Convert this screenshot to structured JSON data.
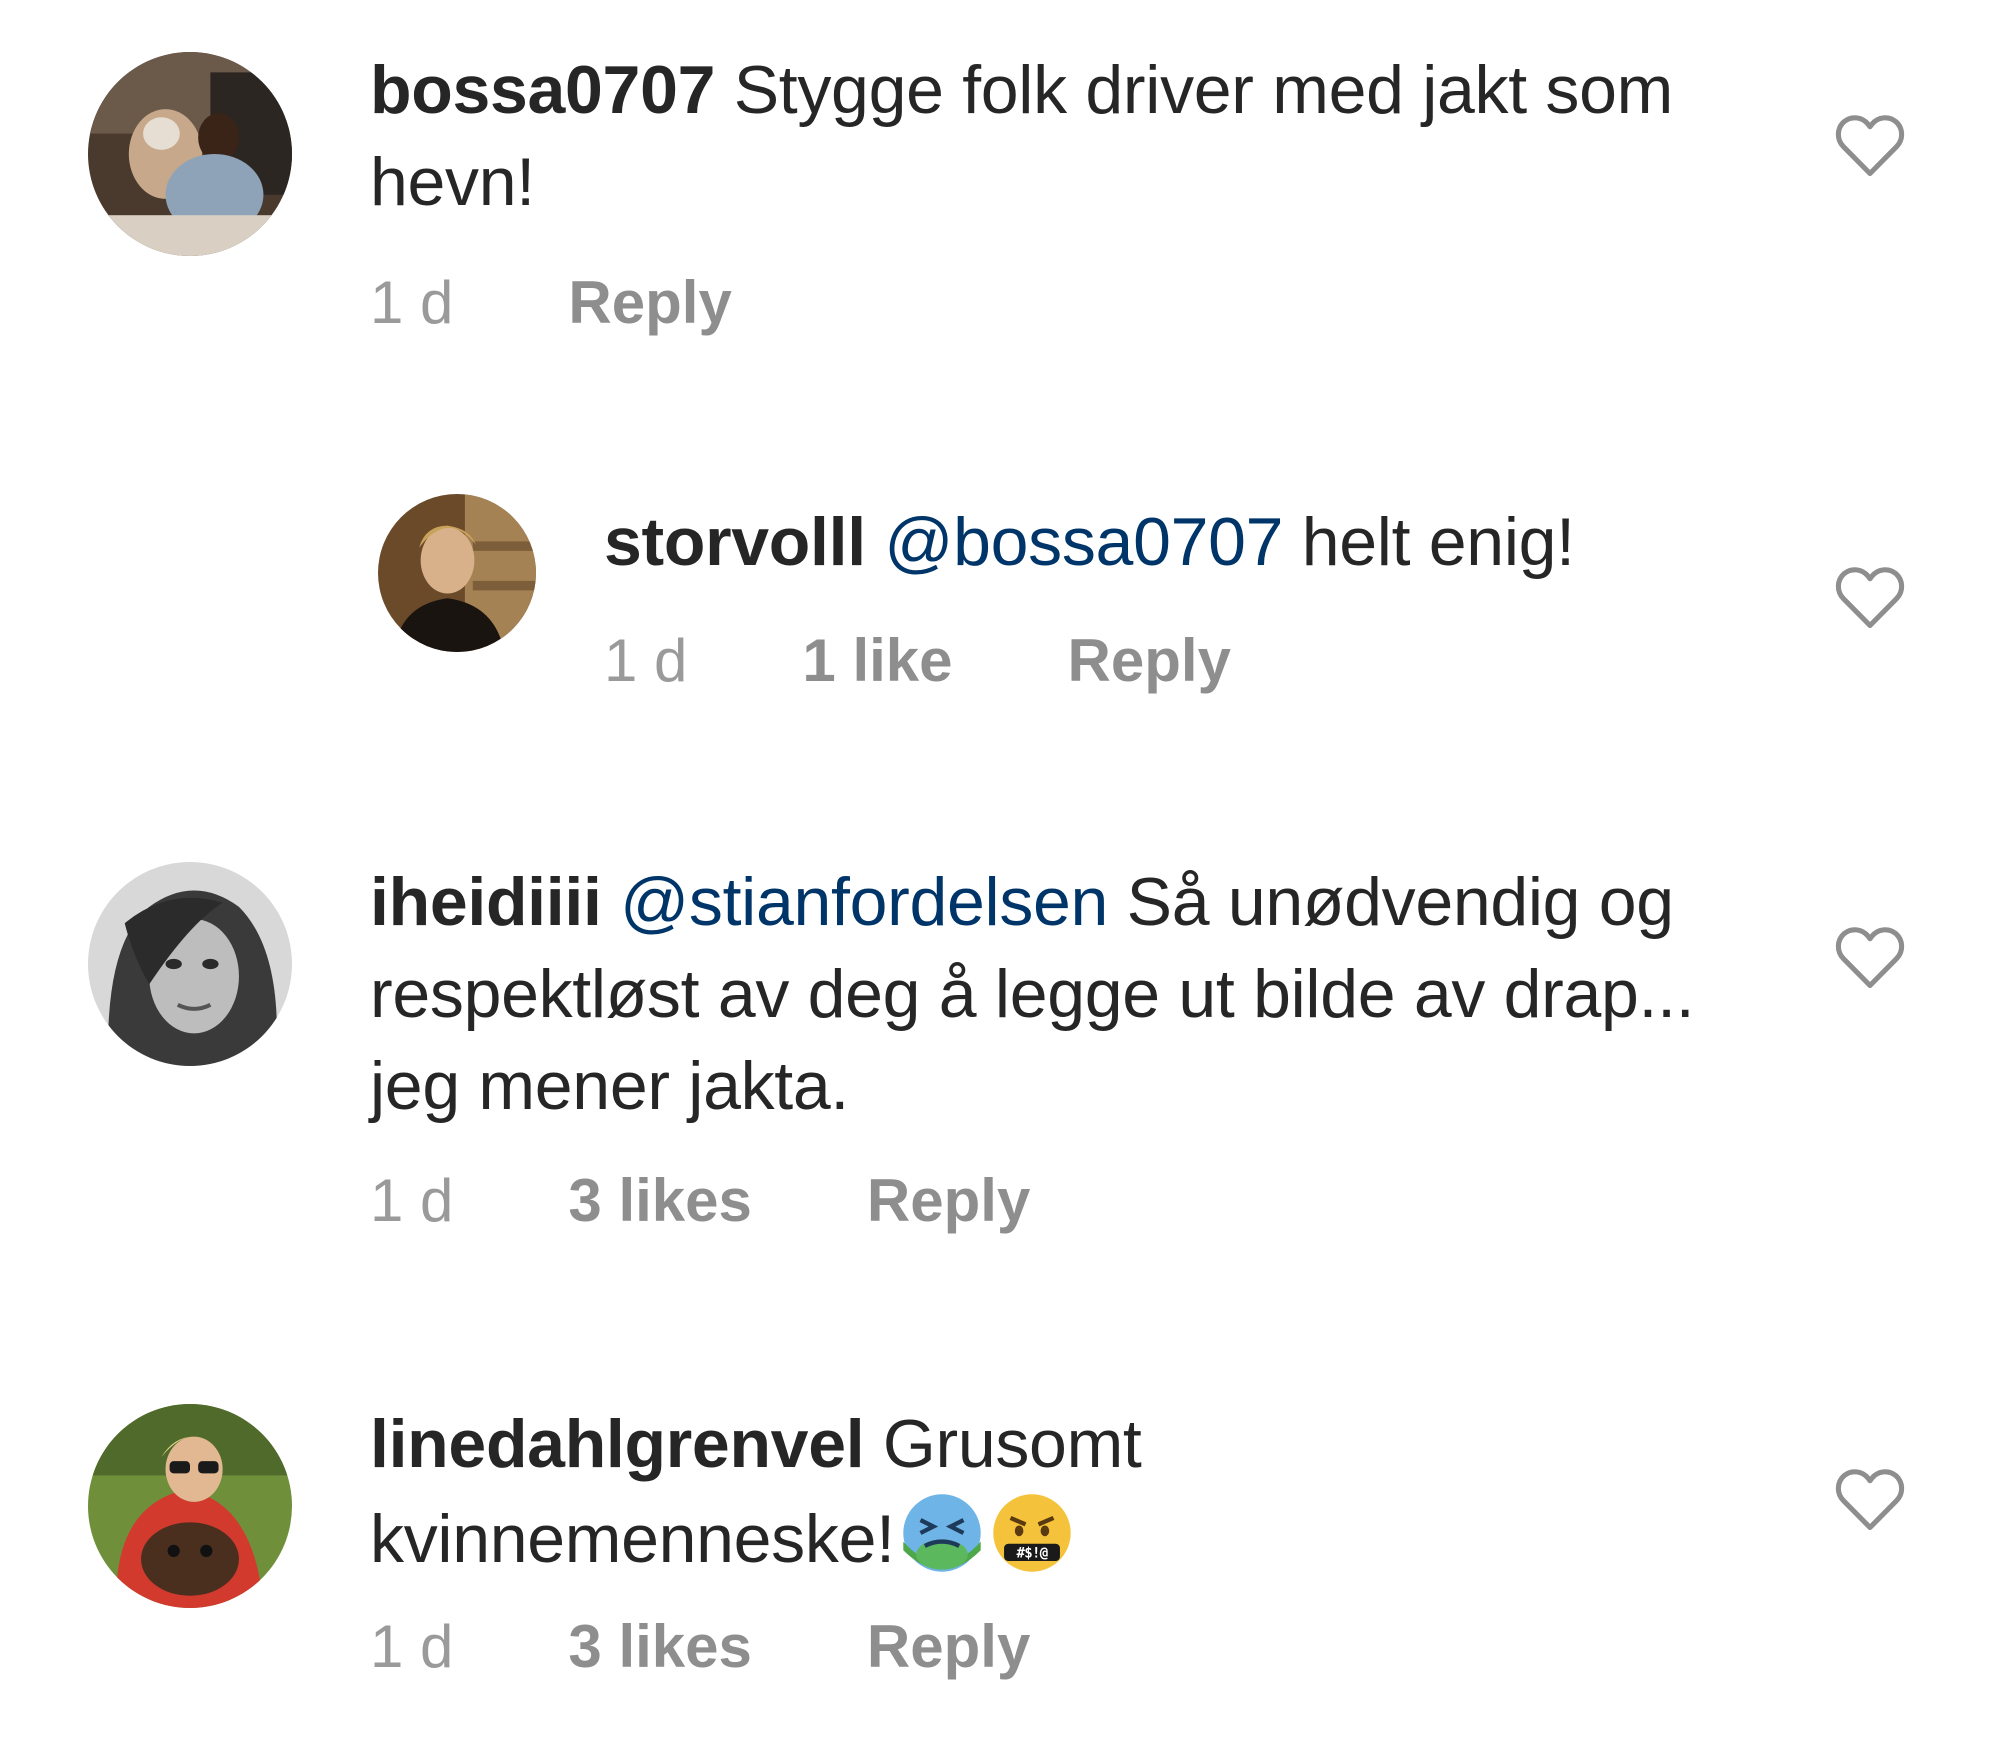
{
  "comments": [
    {
      "username": "bossa0707",
      "mention": "",
      "text": "Stygge folk driver med jakt som hevn!",
      "time": "1 d",
      "likes": "",
      "reply_label": "Reply"
    },
    {
      "username": "storvolll",
      "mention": "@bossa0707",
      "text": "helt enig!",
      "time": "1 d",
      "likes": "1 like",
      "reply_label": "Reply"
    },
    {
      "username": "iheidiiii",
      "mention": "@stianfordelsen",
      "text": "Så unødvendig og respektløst av deg å legge ut bilde av drap... jeg mener jakta.",
      "time": "1 d",
      "likes": "3 likes",
      "reply_label": "Reply"
    },
    {
      "username": "linedahlgrenvel",
      "mention": "",
      "text": "Grusomt kvinnemenneske!",
      "time": "1 d",
      "likes": "3 likes",
      "reply_label": "Reply",
      "emojis": [
        "nauseated-face-emoji",
        "face-with-symbols-on-mouth-emoji"
      ]
    }
  ],
  "colors": {
    "text": "#262626",
    "mention": "#003569",
    "meta": "#8e8e8e",
    "heart_outline": "#8e8e8e"
  }
}
